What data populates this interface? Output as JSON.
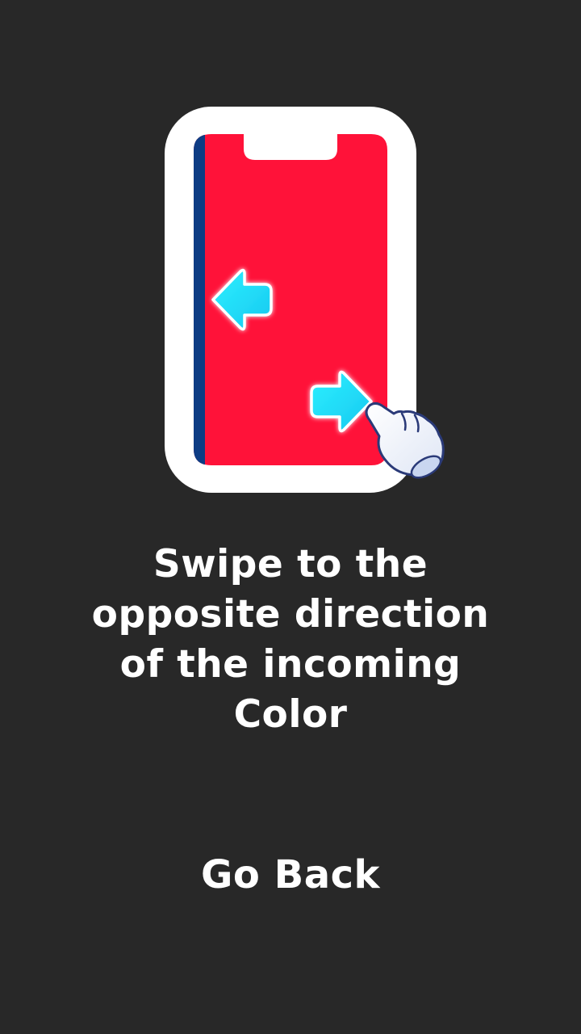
{
  "tutorial": {
    "instruction_lines": [
      "Swipe to the",
      "opposite direction",
      "of the incoming",
      "Color"
    ],
    "go_back_label": "Go Back"
  },
  "illustration": {
    "phone_frame_color": "#ffffff",
    "screen_color": "#ff1239",
    "incoming_color": "#0d3c84",
    "arrow_color": "#1ee2ff",
    "icons": [
      "phone-icon",
      "left-arrow-icon",
      "right-arrow-icon",
      "pointing-hand-icon"
    ]
  },
  "colors": {
    "background": "#282828",
    "text": "#ffffff"
  }
}
